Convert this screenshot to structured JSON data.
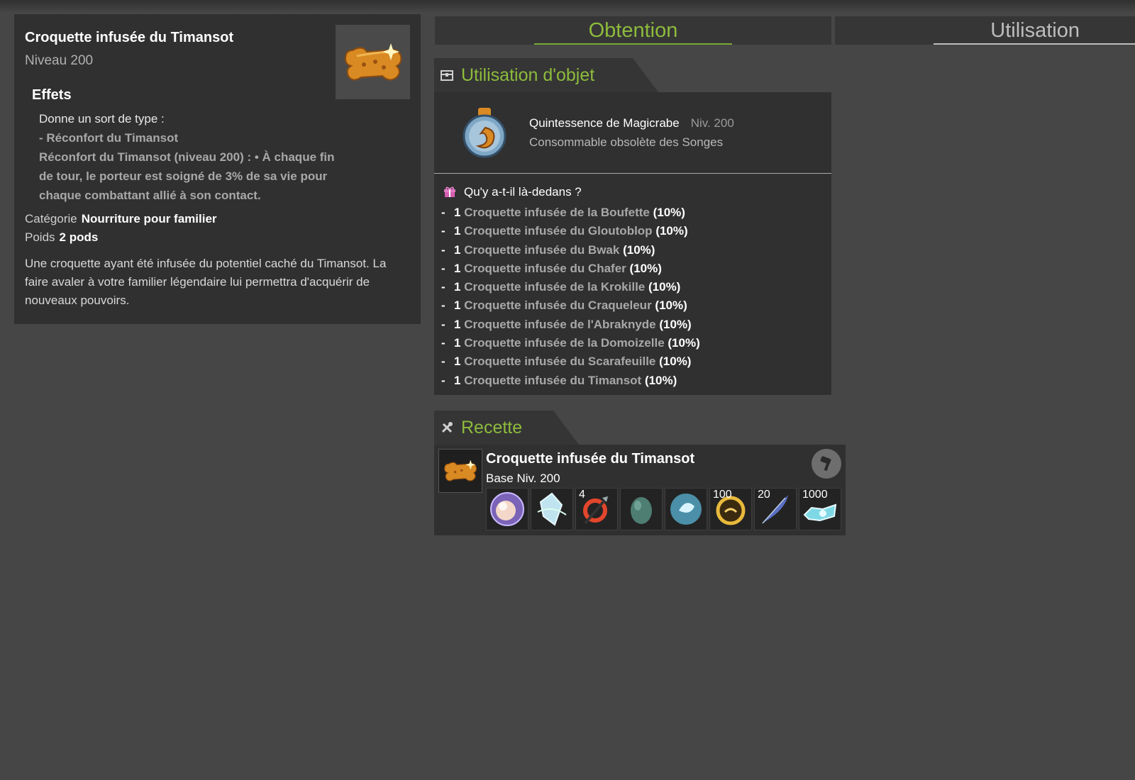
{
  "item": {
    "title": "Croquette infusée du Timansot",
    "level": "Niveau 200",
    "icon": "croquette-bone-icon",
    "effects_title": "Effets",
    "effects_intro": "Donne un sort de type :",
    "effects_spell": "- Réconfort du Timansot",
    "effects_desc": "Réconfort du Timansot (niveau 200) : • À chaque fin de tour, le porteur est soigné de 3% de sa vie pour chaque combattant allié à son contact.",
    "category_label": "Catégorie",
    "category_value": "Nourriture pour familier",
    "weight_label": "Poids",
    "weight_value": "2 pods",
    "description": "Une croquette ayant été infusée du potentiel caché du Timansot. La faire avaler à votre familier légendaire lui permettra d'acquérir de nouveaux pouvoirs."
  },
  "tabs": {
    "obtention": "Obtention",
    "utilisation": "Utilisation"
  },
  "use_section": {
    "title": "Utilisation d'objet",
    "source_name": "Quintessence de Magicrabe",
    "source_level": "Niv. 200",
    "source_type": "Consommable obsolète des Songes",
    "contents_title": "Qu'y a-t-il là-dedans ?",
    "drops": [
      {
        "qty": "1",
        "name": "Croquette infusée de la Boufette",
        "rate": "(10%)"
      },
      {
        "qty": "1",
        "name": "Croquette infusée du Gloutoblop",
        "rate": "(10%)"
      },
      {
        "qty": "1",
        "name": "Croquette infusée du Bwak",
        "rate": "(10%)"
      },
      {
        "qty": "1",
        "name": "Croquette infusée du Chafer",
        "rate": "(10%)"
      },
      {
        "qty": "1",
        "name": "Croquette infusée de la Krokille",
        "rate": "(10%)"
      },
      {
        "qty": "1",
        "name": "Croquette infusée du Craqueleur",
        "rate": "(10%)"
      },
      {
        "qty": "1",
        "name": "Croquette infusée de l'Abraknyde",
        "rate": "(10%)"
      },
      {
        "qty": "1",
        "name": "Croquette infusée de la Domoizelle",
        "rate": "(10%)"
      },
      {
        "qty": "1",
        "name": "Croquette infusée du Scarafeuille",
        "rate": "(10%)"
      },
      {
        "qty": "1",
        "name": "Croquette infusée du Timansot",
        "rate": "(10%)"
      }
    ]
  },
  "recipe": {
    "title": "Recette",
    "name": "Croquette infusée du Timansot",
    "level": "Base Niv. 200",
    "ingredients": [
      {
        "icon": "orb-icon",
        "qty": ""
      },
      {
        "icon": "crystal-icon",
        "qty": ""
      },
      {
        "icon": "arrow-icon",
        "qty": "4"
      },
      {
        "icon": "egg-icon",
        "qty": ""
      },
      {
        "icon": "spirit-icon",
        "qty": ""
      },
      {
        "icon": "gold-ring-icon",
        "qty": "100"
      },
      {
        "icon": "feather-icon",
        "qty": "20"
      },
      {
        "icon": "gem-pile-icon",
        "qty": "1000"
      }
    ]
  },
  "colors": {
    "accent_green": "#8dbb3c",
    "panel_bg": "#303030",
    "page_bg": "#464646"
  }
}
